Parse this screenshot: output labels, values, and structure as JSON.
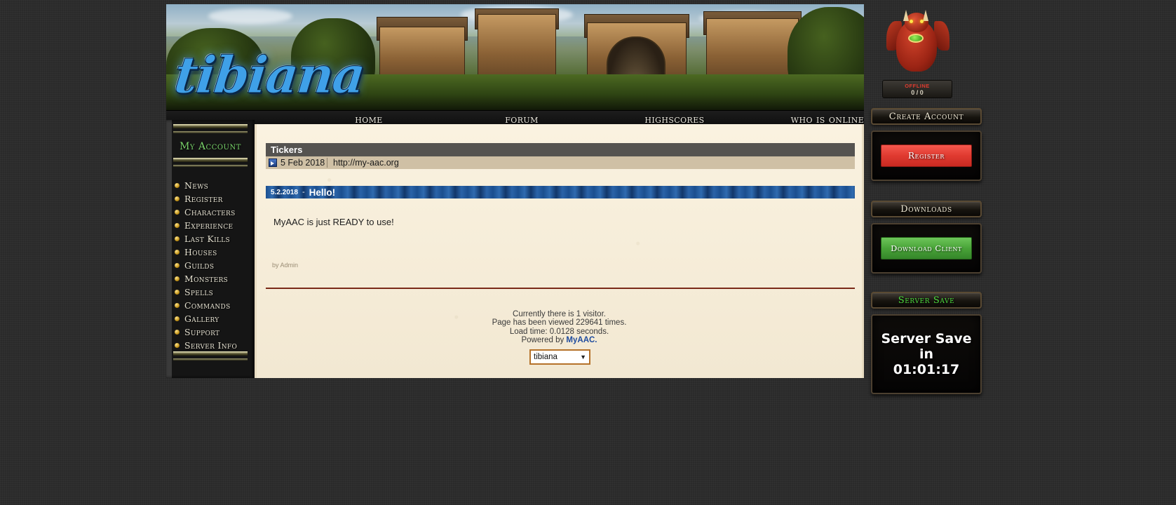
{
  "site": {
    "logo_text": "tibiana"
  },
  "nav": {
    "items": [
      {
        "label": "home",
        "name": "nav-home"
      },
      {
        "label": "forum",
        "name": "nav-forum"
      },
      {
        "label": "highscores",
        "name": "nav-highscores"
      },
      {
        "label": "who is online",
        "name": "nav-who-is-online"
      }
    ]
  },
  "sidebar": {
    "account_label": "My Account",
    "items": [
      {
        "label": "News"
      },
      {
        "label": "Register"
      },
      {
        "label": "Characters"
      },
      {
        "label": "Experience"
      },
      {
        "label": "Last Kills"
      },
      {
        "label": "Houses"
      },
      {
        "label": "Guilds"
      },
      {
        "label": "Monsters"
      },
      {
        "label": "Spells"
      },
      {
        "label": "Commands"
      },
      {
        "label": "Gallery"
      },
      {
        "label": "Support"
      },
      {
        "label": "Server Info"
      }
    ]
  },
  "tickers": {
    "header": "Tickers",
    "date": "5 Feb 2018",
    "url": "http://my-aac.org"
  },
  "news": {
    "date": "5.2.2018",
    "dash": "-",
    "title": "Hello!",
    "body": "MyAAC is just READY to use!",
    "author": "by Admin"
  },
  "footer": {
    "visitors": "Currently there is 1 visitor.",
    "views": "Page has been viewed 229641 times.",
    "loadtime": "Load time: 0.0128 seconds.",
    "powered_prefix": "Powered by ",
    "powered_link": "MyAAC.",
    "server_select": "tibiana",
    "select_arrow": "▼"
  },
  "rightbar": {
    "status_offline": "OFFLINE",
    "status_count": "0 / 0",
    "create_account_title": "Create Account",
    "register_button": "Register",
    "downloads_title": "Downloads",
    "download_button": "Download Client",
    "server_save_title": "Server Save",
    "server_save_line1": "Server Save",
    "server_save_line2": "in",
    "server_save_time": "01:01:17"
  },
  "colors": {
    "accent_green": "#79d36a",
    "register_red": "#e03a30",
    "download_green": "#49a438",
    "news_blue": "#1b4f8f",
    "parchment": "#f5ecd8"
  }
}
